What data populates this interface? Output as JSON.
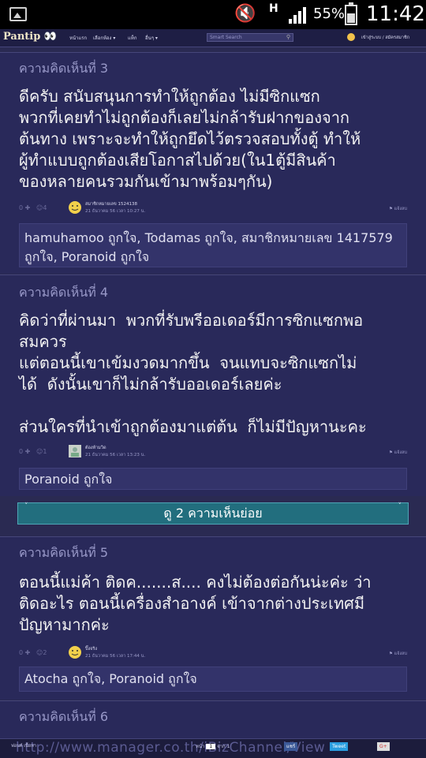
{
  "status_bar": {
    "net_type": "H",
    "battery_pct": "55%",
    "battery_level": 0.55,
    "time": "11:42"
  },
  "nav": {
    "logo": "Pantip",
    "items": [
      "หน้าแรก",
      "เลือกห้อง ▾",
      "แท็ก",
      "อื่นๆ ▾"
    ],
    "search_placeholder": "Smart Search",
    "login": "เข้าสู่ระบบ / สมัครสมาชิก"
  },
  "comments": [
    {
      "number": "ความคิดเห็นที่ 3",
      "text": "ดีครับ สนับสนุนการทำให้ถูกต้อง ไม่มีซิกแซก\nพวกที่เคยทำไม่ถูกต้องก็เลยไม่กล้ารับฝากของจาก\nต้นทาง เพราะจะทำให้ถูกยึดไว้ตรวจสอบทั้งตู้ ทำให้\nผู้ทำแบบถูกต้องเสียโอกาสไปด้วย(ใน1ตู้มีสินค้า\nของหลายคนรวมกันเข้ามาพร้อมๆกัน)",
      "vote": "0",
      "emo": "4",
      "user": "สมาชิกหมายเลข 1524138",
      "date": "21 ธันวาคม 56 เวลา 10:27 น.",
      "report": "แจ้งลบ",
      "likes": "hamuhamoo ถูกใจ, Todamas ถูกใจ, สมาชิกหมายเลข 1417579 ถูกใจ, Poranoid ถูกใจ"
    },
    {
      "number": "ความคิดเห็นที่ 4",
      "text": "คิดว่าที่ผ่านมา  พวกที่รับพรีออเดอร์มีการซิกแซกพอ\nสมควร\nแต่ตอนนี้เขาเข้มงวดมากขึ้น  จนแทบจะซิกแซกไม่\nได้  ดังนั้นเขาก็ไม่กล้ารับออเดอร์เลยค่ะ\n\nส่วนใครที่นำเข้าถูกต้องมาแต่ต้น  ก็ไม่มีปัญหานะคะ",
      "vote": "0",
      "emo": "1",
      "user": "ต้องห้ามวิด",
      "date": "21 ธันวาคม 56 เวลา 13:23 น.",
      "report": "แจ้งลบ",
      "likes": "Poranoid ถูกใจ"
    },
    {
      "number": "ความคิดเห็นที่ 5",
      "text": "ตอนนี้แม่ค้า ติดค.......ส.... คงไม่ต้องต่อกันน่ะค่ะ ว่า\nติดอะไร ตอนนี้เครื่องสำอางค์ เข้าจากต่างประเทศมี\nปัญหามากค่ะ",
      "vote": "0",
      "emo": "2",
      "user": "ปิ๊งจริง",
      "date": "21 ธันวาคม 56 เวลา 17:44 น.",
      "report": "แจ้งลบ",
      "likes": "Atocha ถูกใจ, Poranoid ถูกใจ"
    },
    {
      "number": "ความคิดเห็นที่ 6"
    }
  ],
  "sub_comments_label": "ดู 2 ความเห็นย่อย",
  "bottom": {
    "left": "ฟอนต์ เนื้อหา",
    "url": "http://www.manager.co.th/iBizChannel/View",
    "page_label": "หน้า",
    "page_value": "1",
    "page_of": "จาก 1",
    "share": [
      "แชร์",
      "Tweet",
      "G+"
    ]
  },
  "colors": {
    "bg": "#2a2a52",
    "comment_bg": "#29295a",
    "accent": "#226e7e"
  }
}
